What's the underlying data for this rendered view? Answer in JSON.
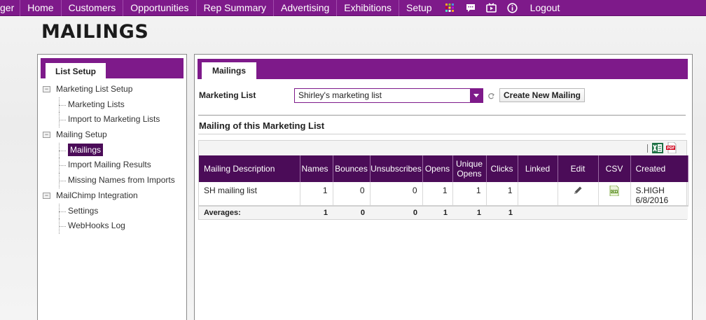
{
  "nav": {
    "items": [
      "ger",
      "Home",
      "Customers",
      "Opportunities",
      "Rep Summary",
      "Advertising",
      "Exhibitions",
      "Setup"
    ],
    "icons": [
      "grid-icon",
      "chat-icon",
      "video-icon",
      "info-icon"
    ],
    "logout": "Logout",
    "color": "#7e1a8a"
  },
  "page": {
    "title": "MAILINGS"
  },
  "sidebar": {
    "tab": "List Setup",
    "tree": [
      {
        "label": "Marketing List Setup",
        "level": 0
      },
      {
        "label": "Marketing Lists",
        "level": 1
      },
      {
        "label": "Import to Marketing Lists",
        "level": 1
      },
      {
        "label": "Mailing Setup",
        "level": 0
      },
      {
        "label": "Mailings",
        "level": 1,
        "selected": true
      },
      {
        "label": "Import Mailing Results",
        "level": 1
      },
      {
        "label": "Missing Names from Imports",
        "level": 1
      },
      {
        "label": "MailChimp Integration",
        "level": 0
      },
      {
        "label": "Settings",
        "level": 1
      },
      {
        "label": "WebHooks Log",
        "level": 1
      }
    ]
  },
  "main": {
    "tab": "Mailings",
    "marketing_list_label": "Marketing List",
    "marketing_list_value": "Shirley's marketing list",
    "create_button": "Create New Mailing",
    "section_title": "Mailing of this Marketing List",
    "table": {
      "headers": [
        "Mailing Description",
        "Names",
        "Bounces",
        "Unsubscribes",
        "Opens",
        "Unique Opens",
        "Clicks",
        "Linked",
        "Edit",
        "CSV",
        "Created"
      ],
      "rows": [
        {
          "description": "SH mailing list",
          "names": "1",
          "bounces": "0",
          "unsubscribes": "0",
          "opens": "1",
          "unique_opens": "1",
          "clicks": "1",
          "linked": "",
          "edit_icon": "pencil-icon",
          "csv_icon": "csv-file-icon",
          "created_by": "S.HIGH",
          "created_date": "6/8/2016"
        }
      ],
      "averages": {
        "label": "Averages:",
        "names": "1",
        "bounces": "0",
        "unsubscribes": "0",
        "opens": "1",
        "unique_opens": "1",
        "clicks": "1"
      }
    }
  }
}
